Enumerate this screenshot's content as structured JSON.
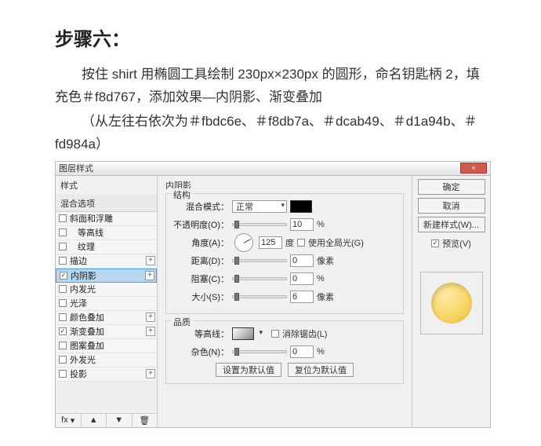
{
  "instruction": {
    "title": "步骤六：",
    "line1": "按住 shirt 用椭圆工具绘制 230px×230px 的圆形，命名钥匙柄 2，填充色＃f8d767，添加效果—内阴影、渐变叠加",
    "line2": "（从左往右依次为＃fbdc6e、＃f8db7a、＃dcab49、＃d1a94b、＃fd984a）"
  },
  "dialog": {
    "title": "图层样式",
    "close_x": "×",
    "left": {
      "style_head": "样式",
      "blend_head": "混合选项",
      "items": [
        {
          "label": "斜面和浮雕",
          "checked": false,
          "plus": false
        },
        {
          "label": "等高线",
          "checked": false,
          "plus": false,
          "indent": true
        },
        {
          "label": "纹理",
          "checked": false,
          "plus": false,
          "indent": true
        },
        {
          "label": "描边",
          "checked": false,
          "plus": true
        },
        {
          "label": "内阴影",
          "checked": true,
          "plus": true,
          "selected": true
        },
        {
          "label": "内发光",
          "checked": false,
          "plus": false
        },
        {
          "label": "光泽",
          "checked": false,
          "plus": false
        },
        {
          "label": "颜色叠加",
          "checked": false,
          "plus": true
        },
        {
          "label": "渐变叠加",
          "checked": true,
          "plus": true
        },
        {
          "label": "图案叠加",
          "checked": false,
          "plus": false
        },
        {
          "label": "外发光",
          "checked": false,
          "plus": false
        },
        {
          "label": "投影",
          "checked": false,
          "plus": true
        }
      ],
      "fx_label": "fx",
      "dd_icon": "▾",
      "trash_icon": "🗑"
    },
    "center": {
      "tab_title": "内阴影",
      "group_struct": "结构",
      "blend_mode_label": "混合模式：",
      "blend_mode_value": "正常",
      "opacity_label": "不透明度(O)：",
      "opacity_value": "10",
      "opacity_unit": "%",
      "angle_label": "角度(A)：",
      "angle_value": "125",
      "angle_unit": "度",
      "global_light_label": "使用全局光(G)",
      "distance_label": "距离(D)：",
      "distance_value": "0",
      "distance_unit": "像素",
      "spread_label": "阻塞(C)：",
      "spread_value": "0",
      "spread_unit": "%",
      "size_label": "大小(S)：",
      "size_value": "6",
      "size_unit": "像素",
      "group_quality": "品质",
      "contour_label": "等高线：",
      "antialias_label": "消除锯齿(L)",
      "noise_label": "杂色(N)：",
      "noise_value": "0",
      "noise_unit": "%",
      "btn_default": "设置为默认值",
      "btn_reset": "复位为默认值"
    },
    "right": {
      "ok": "确定",
      "cancel": "取消",
      "new_style": "新建样式(W)...",
      "preview": "预览(V)"
    }
  }
}
